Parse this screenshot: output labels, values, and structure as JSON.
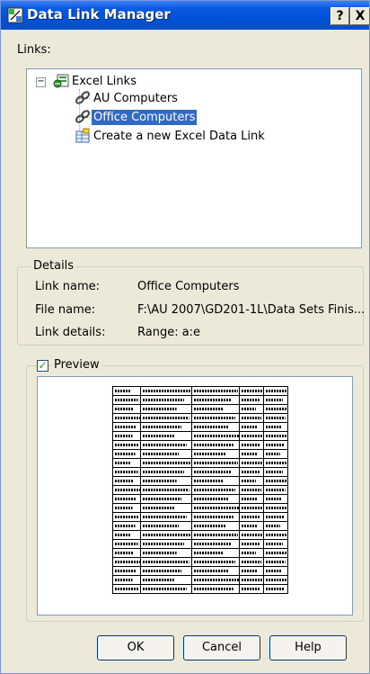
{
  "window": {
    "title": "Data Link Manager",
    "help_btn": "?",
    "close_btn": "X"
  },
  "links": {
    "label": "Links:",
    "root": "Excel Links",
    "items": [
      {
        "label": "AU Computers",
        "selected": false
      },
      {
        "label": "Office Computers",
        "selected": true
      },
      {
        "label": "Create a new Excel Data Link",
        "selected": false
      }
    ]
  },
  "details": {
    "title": "Details",
    "rows": [
      {
        "label": "Link name:",
        "value": "Office Computers"
      },
      {
        "label": "File name:",
        "value": "F:\\AU 2007\\GD201-1L\\Data Sets Finis..."
      },
      {
        "label": "Link details:",
        "value": "Range: a:e"
      }
    ]
  },
  "preview": {
    "label": "Preview",
    "checked": true,
    "check_mark": "✓"
  },
  "buttons": {
    "ok": "OK",
    "cancel": "Cancel",
    "help": "Help"
  },
  "colors": {
    "titlebar": "#0052d8",
    "selection": "#316ac5",
    "dialog_bg": "#ece9d8"
  },
  "icons": {
    "tree_root": "excel-links-icon",
    "link": "chain-link-icon",
    "new_link": "new-excel-link-icon"
  }
}
